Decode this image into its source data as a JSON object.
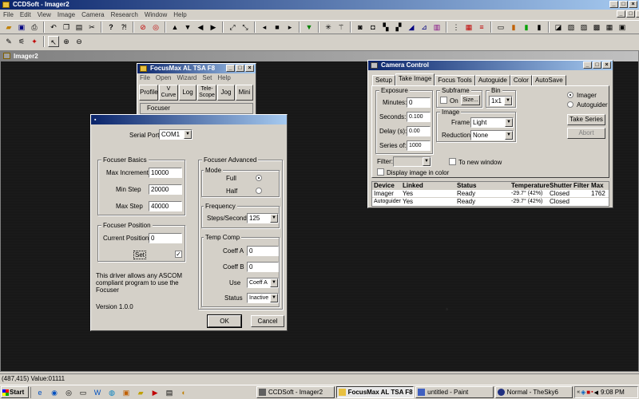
{
  "app": {
    "title": "CCDSoft - Imager2",
    "menus": [
      "File",
      "Edit",
      "View",
      "Image",
      "Camera",
      "Research",
      "Window",
      "Help"
    ]
  },
  "doc_window": {
    "title": "Imager2"
  },
  "status_bar": {
    "text": "(487,415) Value:01111"
  },
  "focusmax": {
    "title": "FocusMax  AL TSA F8",
    "menus": [
      "File",
      "Open",
      "Wizard",
      "Set",
      "Help"
    ],
    "buttons": [
      "Profile",
      "V Curve",
      "Log",
      "Tele-Scope",
      "Jog",
      "Mini"
    ],
    "focuser_label": "Focuser"
  },
  "settings_dialog": {
    "serial_port_label": "Serial Port:",
    "serial_port_value": "COM1",
    "basics": {
      "label": "Focuser Basics",
      "max_increment_label": "Max Increment",
      "max_increment": "10000",
      "min_step_label": "Min Step",
      "min_step": "20000",
      "max_step_label": "Max Step",
      "max_step": "40000"
    },
    "position": {
      "label": "Focuser Position",
      "current_label": "Current Position",
      "current": "0",
      "set_label": "Set"
    },
    "note": "This driver allows any ASCOM compliant program to use the Focuser",
    "version": "Version 1.0.0",
    "advanced": {
      "label": "Focuser Advanced",
      "mode_label": "Mode",
      "full_label": "Full",
      "half_label": "Half",
      "frequency_label": "Frequency",
      "steps_label": "Steps/Second",
      "steps_value": "125",
      "tempcomp_label": "Temp Comp",
      "coeff_a_label": "Coeff A",
      "coeff_a": "0",
      "coeff_b_label": "Coeff B",
      "coeff_b": "0",
      "use_label": "Use",
      "use_value": "Coeff A",
      "status_label": "Status",
      "status_value": "Inactive"
    },
    "ok_label": "OK",
    "cancel_label": "Cancel"
  },
  "camera_control": {
    "title": "Camera Control",
    "tabs": [
      "Setup",
      "Take Image",
      "Focus Tools",
      "Autoguide",
      "Color",
      "AutoSave"
    ],
    "exposure_label": "Exposure",
    "minutes_label": "Minutes:",
    "minutes": "0",
    "seconds_label": "Seconds:",
    "seconds": "0.100",
    "delay_label": "Delay (s):",
    "delay": "0.00",
    "series_label": "Series of:",
    "series": "1000",
    "subframe_label": "Subframe",
    "on_label": "On",
    "size_label": "Size...",
    "bin_label": "Bin",
    "bin_value": "1x1",
    "image_label": "Image",
    "frame_label": "Frame:",
    "frame_value": "Light",
    "reduction_label": "Reduction:",
    "reduction_value": "None",
    "imager_label": "Imager",
    "autoguider_label": "Autoguider",
    "take_series_label": "Take Series",
    "abort_label": "Abort",
    "filter_label": "Filter:",
    "to_new_window_label": "To new window",
    "display_color_label": "Display image in color",
    "table_headers": [
      "Device",
      "Linked",
      "Status",
      "Temperature",
      "Shutter",
      "Filter",
      "Max"
    ],
    "rows": [
      [
        "Imager",
        "Yes",
        "Ready",
        "-29.7° (42%)",
        "Closed",
        "",
        "1762"
      ],
      [
        "Autoguider",
        "Yes",
        "Ready",
        "-29.7° (42%)",
        "Closed",
        "",
        ""
      ]
    ]
  },
  "taskbar": {
    "start_label": "Start",
    "tasks": [
      "CCDSoft - Imager2",
      "FocusMax  AL TSA F8",
      "untitled - Paint",
      "Normal - TheSky6"
    ],
    "clock": "9:08 PM"
  }
}
